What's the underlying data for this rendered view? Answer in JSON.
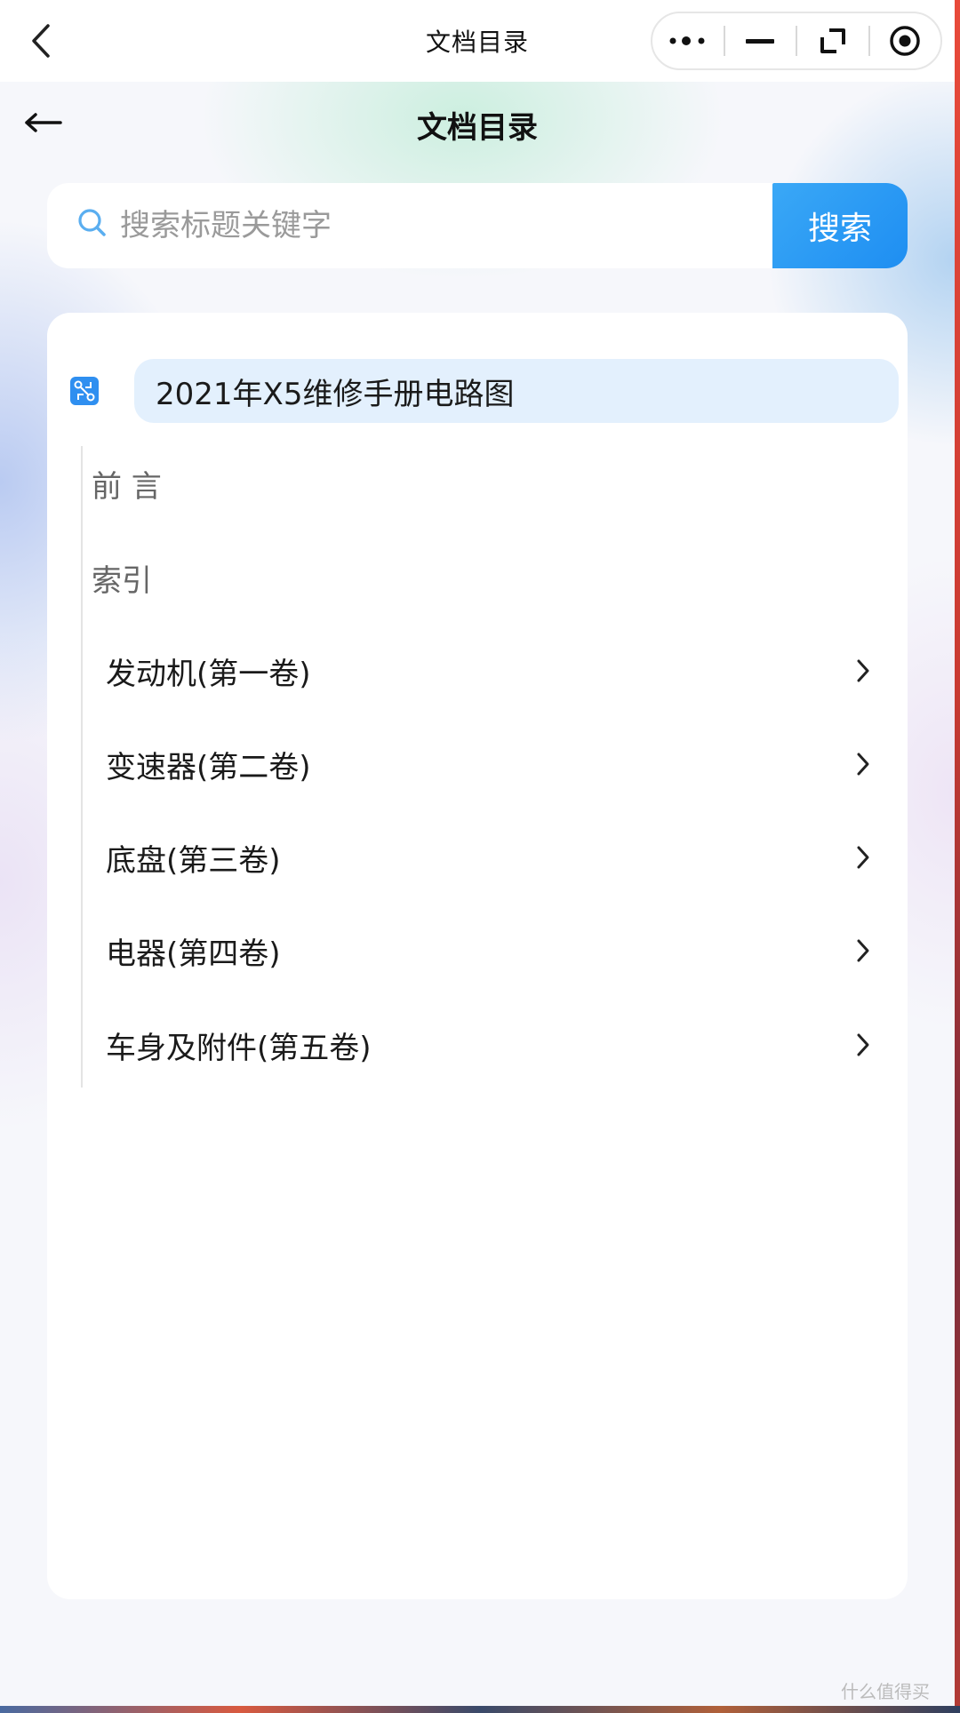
{
  "topbar": {
    "title": "文档目录",
    "icons": [
      "back-chevron-icon",
      "more-dots-icon",
      "minimize-icon",
      "expand-icon",
      "record-icon"
    ]
  },
  "page": {
    "title": "文档目录",
    "back_icon": "left-arrow-icon"
  },
  "search": {
    "placeholder": "搜索标题关键字",
    "button_label": "搜索",
    "icon": "search-icon"
  },
  "tree": {
    "root_label": "2021年X5维修手册电路图",
    "root_icon": "circuit-icon",
    "items": [
      {
        "label": "前 言",
        "has_children": false
      },
      {
        "label": "索引",
        "has_children": false
      },
      {
        "label": "发动机(第一卷)",
        "has_children": true
      },
      {
        "label": "变速器(第二卷)",
        "has_children": true
      },
      {
        "label": "底盘(第三卷)",
        "has_children": true
      },
      {
        "label": "电器(第四卷)",
        "has_children": true
      },
      {
        "label": "车身及附件(第五卷)",
        "has_children": true
      }
    ]
  },
  "watermark": "什么值得买",
  "colors": {
    "accent": "#1e8ef2",
    "root_highlight": "#e3f0fd"
  }
}
